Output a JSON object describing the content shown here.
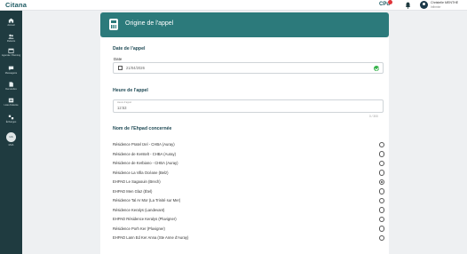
{
  "app": {
    "logo": "Citana"
  },
  "topbar": {
    "cpu_label": "CPu",
    "bell_icon": "bell-icon",
    "user_name": "Christelle MENTHE",
    "user_role": "Infirmier"
  },
  "sidebar": {
    "items": [
      {
        "label": "Accueil",
        "icon": "home-icon"
      },
      {
        "label": "Patients",
        "icon": "users-icon"
      },
      {
        "label": "Agenda / Planning",
        "icon": "calendar-icon"
      },
      {
        "label": "Messagerie",
        "icon": "chat-icon"
      },
      {
        "label": "Demandes",
        "icon": "document-icon"
      },
      {
        "label": "Liste d'attente",
        "icon": "list-icon"
      },
      {
        "label": "Échanges",
        "icon": "exchange-icon"
      }
    ],
    "round_badge": "GS",
    "round_label": "MUA"
  },
  "header": {
    "title": "Origine de l'appel",
    "icon": "phone-form-icon"
  },
  "form": {
    "date_section_title": "Date de l'appel",
    "date_label": "Date",
    "date_value": "21/04/2026",
    "time_section_title": "Heure de l'appel",
    "time_float_label": "Heure d'appel",
    "time_value": "12:53",
    "char_count": "0 / 300",
    "ehpad_section_title": "Nom de l'Ehpad concernée",
    "options": [
      {
        "label": "Résidence Pratel Izel - CHBA (Auray)",
        "selected": false
      },
      {
        "label": "Résidence de Kerstelt - CHBA (Auray)",
        "selected": false
      },
      {
        "label": "Résidence de Kerbiano - CHBA (Auray)",
        "selected": false
      },
      {
        "label": "Résidence La Villa Océane (Belz)",
        "selected": false
      },
      {
        "label": "EHPAD Le Sagaouin (Brech)",
        "selected": true
      },
      {
        "label": "EHPAD Men Glaz (Étel)",
        "selected": false
      },
      {
        "label": "Résidence Tal Ar Mor (La Trinité sur Mer)",
        "selected": false
      },
      {
        "label": "Résidence Keralys (Landevant)",
        "selected": false
      },
      {
        "label": "EHPAD Résidence Keralys (Pluvigner)",
        "selected": false
      },
      {
        "label": "Résidence Porh Ker (Pluvigner)",
        "selected": false
      },
      {
        "label": "EHPAD Lann Ed Ker Anna (Ste Anne d'Auray)",
        "selected": false
      }
    ]
  },
  "colors": {
    "sidebar": "#1f3b40",
    "header": "#2c7a7b",
    "title_text": "#1f4a55",
    "valid": "#35b24a",
    "notification": "#e0353a"
  }
}
